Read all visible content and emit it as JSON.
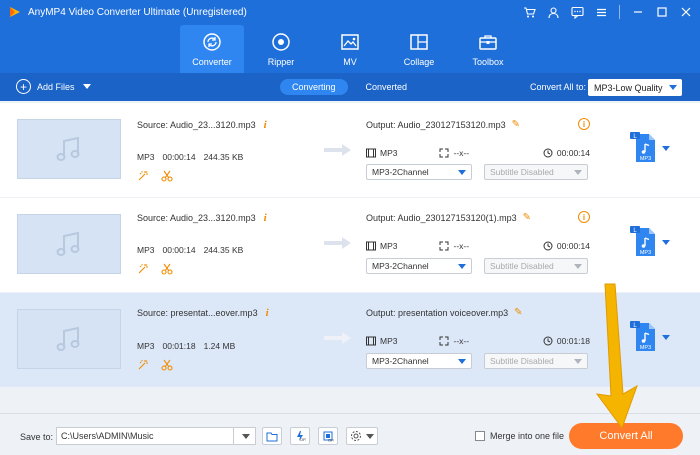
{
  "app": {
    "title": "AnyMP4 Video Converter Ultimate (Unregistered)"
  },
  "tabs": [
    {
      "label": "Converter",
      "icon": "converter-icon",
      "active": true
    },
    {
      "label": "Ripper",
      "icon": "ripper-icon",
      "active": false
    },
    {
      "label": "MV",
      "icon": "mv-icon",
      "active": false
    },
    {
      "label": "Collage",
      "icon": "collage-icon",
      "active": false
    },
    {
      "label": "Toolbox",
      "icon": "toolbox-icon",
      "active": false
    }
  ],
  "toolbar": {
    "add_files": "Add Files",
    "mode_converting": "Converting",
    "mode_converted": "Converted",
    "convert_all_to": "Convert All to:",
    "format": "MP3-Low Quality"
  },
  "files": [
    {
      "source": "Source: Audio_23...3120.mp3",
      "format": "MP3",
      "duration": "00:00:14",
      "size": "244.35 KB",
      "output": "Output: Audio_230127153120.mp3",
      "out_format": "MP3",
      "out_resolution": "--x--",
      "out_duration": "00:00:14",
      "channel": "MP3-2Channel",
      "subtitle": "Subtitle Disabled",
      "selected": false
    },
    {
      "source": "Source: Audio_23...3120.mp3",
      "format": "MP3",
      "duration": "00:00:14",
      "size": "244.35 KB",
      "output": "Output: Audio_230127153120(1).mp3",
      "out_format": "MP3",
      "out_resolution": "--x--",
      "out_duration": "00:00:14",
      "channel": "MP3-2Channel",
      "subtitle": "Subtitle Disabled",
      "selected": false
    },
    {
      "source": "Source: presentat...eover.mp3",
      "format": "MP3",
      "duration": "00:01:18",
      "size": "1.24 MB",
      "output": "Output: presentation voiceover.mp3",
      "out_format": "MP3",
      "out_resolution": "--x--",
      "out_duration": "00:01:18",
      "channel": "MP3-2Channel",
      "subtitle": "Subtitle Disabled",
      "selected": true
    }
  ],
  "bottom": {
    "save_to": "Save to:",
    "path": "C:\\Users\\ADMIN\\Music",
    "merge": "Merge into one file",
    "convert_all": "Convert All"
  },
  "colors": {
    "header": "#1e6fd9",
    "toolbar": "#1b63c7",
    "accent_orange": "#ff7a2a",
    "overlay_arrow": "#f5b400"
  }
}
